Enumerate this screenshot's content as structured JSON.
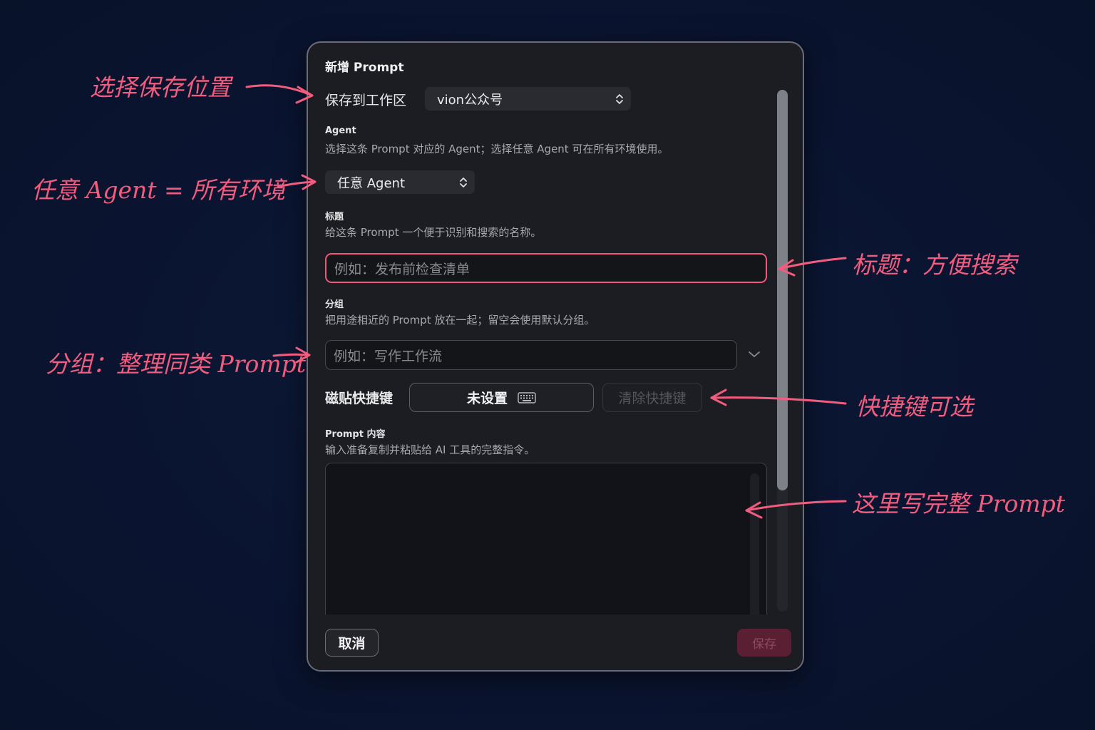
{
  "dialog": {
    "title": "新增 Prompt",
    "workspace": {
      "label": "保存到工作区",
      "value": "vion公众号"
    },
    "agent": {
      "title": "Agent",
      "description": "选择这条 Prompt 对应的 Agent；选择任意 Agent 可在所有环境使用。",
      "value": "任意 Agent"
    },
    "title_field": {
      "title": "标题",
      "description": "给这条 Prompt 一个便于识别和搜索的名称。",
      "placeholder": "例如：发布前检查清单"
    },
    "group_field": {
      "title": "分组",
      "description": "把用途相近的 Prompt 放在一起；留空会使用默认分组。",
      "placeholder": "例如：写作工作流"
    },
    "shortcut": {
      "label": "磁贴快捷键",
      "value": "未设置",
      "clear_label": "清除快捷键"
    },
    "content_field": {
      "title": "Prompt 内容",
      "description": "输入准备复制并粘贴给 AI 工具的完整指令。",
      "value": ""
    },
    "footer": {
      "cancel_label": "取消",
      "save_label": "保存"
    }
  },
  "annotations": {
    "workspace": "选择保存位置",
    "agent": "任意 Agent = 所有环境",
    "title": "标题：方便搜索",
    "group": "分组：整理同类 Prompt",
    "shortcut": "快捷键可选",
    "content": "这里写完整 Prompt"
  },
  "colors": {
    "background": "#0a1530",
    "dialog": "#1c1d22",
    "accent": "#ee5a7a",
    "annotation": "#f25c7e",
    "save_disabled": "#5a1f33"
  },
  "icons": {
    "select_chevron": "chevron-up-down-icon",
    "combo_chevron": "chevron-down-icon",
    "keyboard": "keyboard-icon"
  }
}
